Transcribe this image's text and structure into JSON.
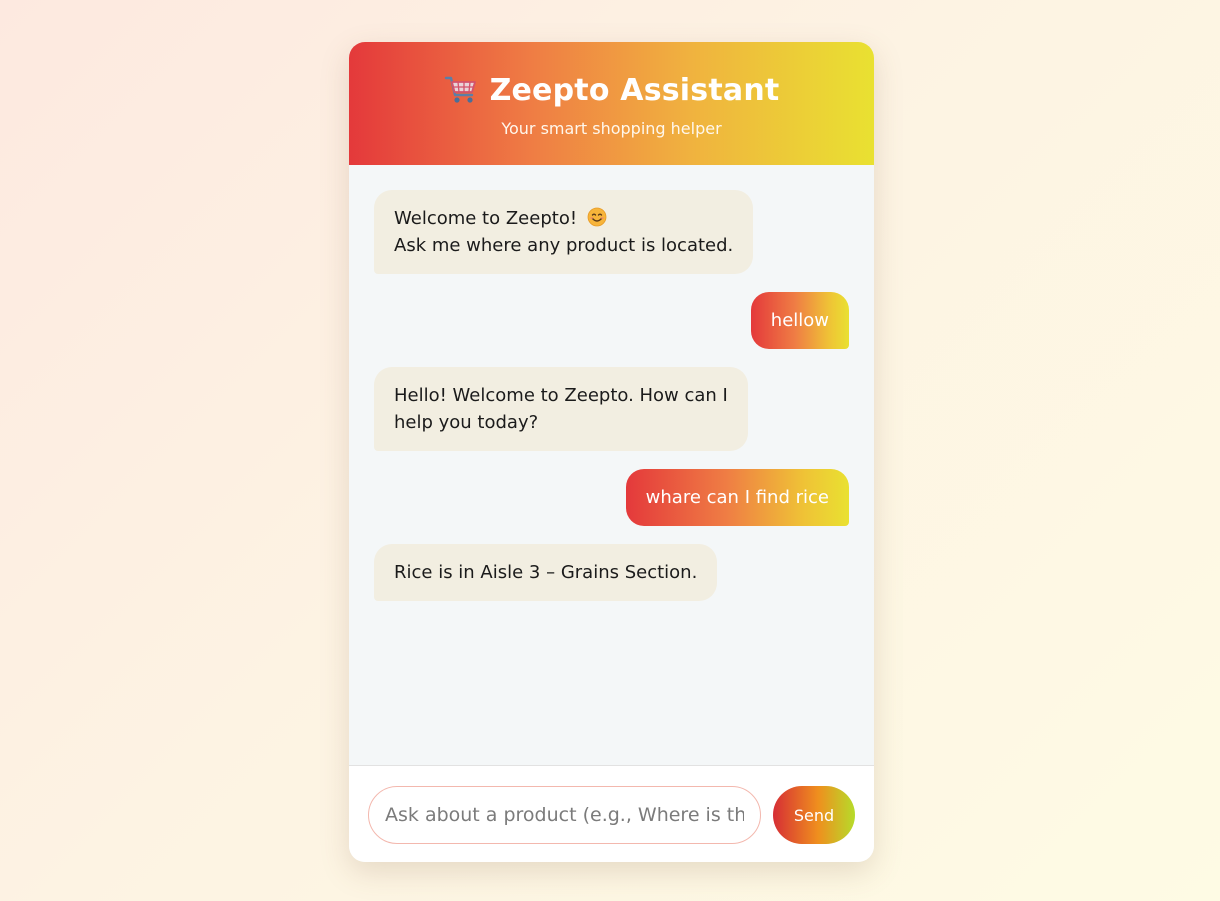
{
  "header": {
    "icon": "shopping-cart-icon",
    "title": "Zeepto Assistant",
    "subtitle": "Your smart shopping helper"
  },
  "messages": [
    {
      "role": "bot",
      "lines": [
        "Welcome to Zeepto! ",
        "Ask me where any product is located."
      ],
      "emoji": "smiling-face-icon"
    },
    {
      "role": "user",
      "text": "hellow"
    },
    {
      "role": "bot",
      "lines": [
        "Hello! Welcome to Zeepto. How can I",
        "help you today?"
      ]
    },
    {
      "role": "user",
      "text": "whare can I find rice"
    },
    {
      "role": "bot",
      "text": "Rice is in Aisle 3 – Grains Section."
    }
  ],
  "input": {
    "placeholder": "Ask about a product (e.g., Where is the milk?)",
    "value": ""
  },
  "send_button": {
    "label": "Send"
  },
  "colors": {
    "header_gradient": [
      "#e4393b",
      "#ef7d44",
      "#f0b23f",
      "#e9e131"
    ],
    "bot_bubble": "#f2eee1",
    "chat_background": "#f4f7f8",
    "send_gradient": [
      "#d62e35",
      "#ef8f1e",
      "#b6dc2a"
    ]
  }
}
